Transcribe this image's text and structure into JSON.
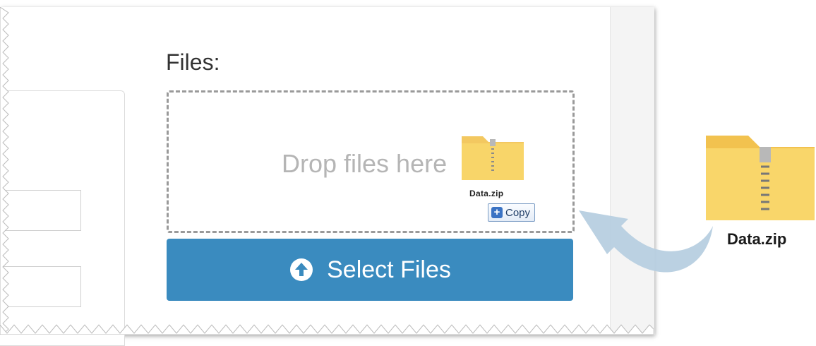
{
  "form": {
    "files_label": "Files:",
    "dropzone_text": "Drop files here",
    "select_button_label": "Select Files"
  },
  "drag": {
    "filename": "Data.zip",
    "copy_tooltip": "Copy"
  },
  "desktop_file": {
    "filename": "Data.zip"
  },
  "colors": {
    "button": "#3a8bbf",
    "folder": "#f9d66a",
    "arrow": "#b7cfe0"
  },
  "icons": [
    "upload-circle-icon",
    "zip-folder-icon",
    "plus-icon",
    "curved-arrow-icon"
  ]
}
